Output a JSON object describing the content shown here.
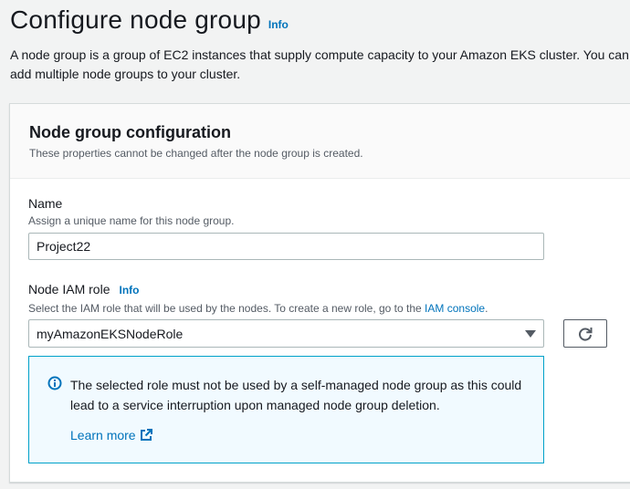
{
  "header": {
    "title": "Configure node group",
    "info_label": "Info",
    "description": "A node group is a group of EC2 instances that supply compute capacity to your Amazon EKS cluster. You can add multiple node groups to your cluster."
  },
  "panel": {
    "title": "Node group configuration",
    "subtitle": "These properties cannot be changed after the node group is created."
  },
  "name_field": {
    "label": "Name",
    "description": "Assign a unique name for this node group.",
    "value": "Project22"
  },
  "iam_role_field": {
    "label": "Node IAM role",
    "info_label": "Info",
    "description_prefix": "Select the IAM role that will be used by the nodes. To create a new role, go to the",
    "description_link": "IAM console",
    "description_suffix": ".",
    "selected_value": "myAmazonEKSNodeRole"
  },
  "alert": {
    "message": "The selected role must not be used by a self-managed node group as this could lead to a service interruption upon managed node group deletion.",
    "link_label": "Learn more"
  },
  "icons": {
    "select_caret": "caret-down-icon",
    "refresh": "refresh-icon",
    "alert": "info-circle-icon",
    "external": "external-link-icon"
  },
  "colors": {
    "link": "#0073bb",
    "alert_border": "#00a1c9",
    "alert_background": "#f1faff",
    "page_background": "#f2f3f3"
  }
}
